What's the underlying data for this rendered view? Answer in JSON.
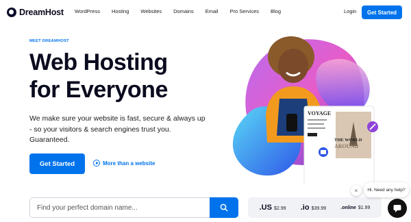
{
  "brand": {
    "name": "DreamHost"
  },
  "nav": {
    "items": [
      {
        "label": "WordPress"
      },
      {
        "label": "Hosting"
      },
      {
        "label": "Websites"
      },
      {
        "label": "Domains"
      },
      {
        "label": "Email"
      },
      {
        "label": "Pro Services"
      },
      {
        "label": "Blog"
      }
    ],
    "login": "Login",
    "cta": "Get Started"
  },
  "hero": {
    "eyebrow": "MEET DREAMHOST",
    "headline_line1": "Web Hosting",
    "headline_line2": "for Everyone",
    "subtext": "We make sure your website is fast, secure & always up - so your visitors & search engines trust you. Guaranteed.",
    "primary_button": "Get Started",
    "secondary_link": "More than a website",
    "mockup_title": "VOYAGE",
    "mockup_image_text": "THE WORLD AROUND"
  },
  "search": {
    "placeholder": "Find your perfect domain name...",
    "value": ""
  },
  "tlds": [
    {
      "name": ".US",
      "price": "$2.99"
    },
    {
      "name": ".io",
      "price": "$39.99"
    },
    {
      "name": ".online",
      "price": "$1.99"
    }
  ],
  "chat": {
    "message": "Hi. Need any help?",
    "close": "×"
  },
  "colors": {
    "accent": "#0073ec",
    "text_dark": "#0b0b1f"
  }
}
